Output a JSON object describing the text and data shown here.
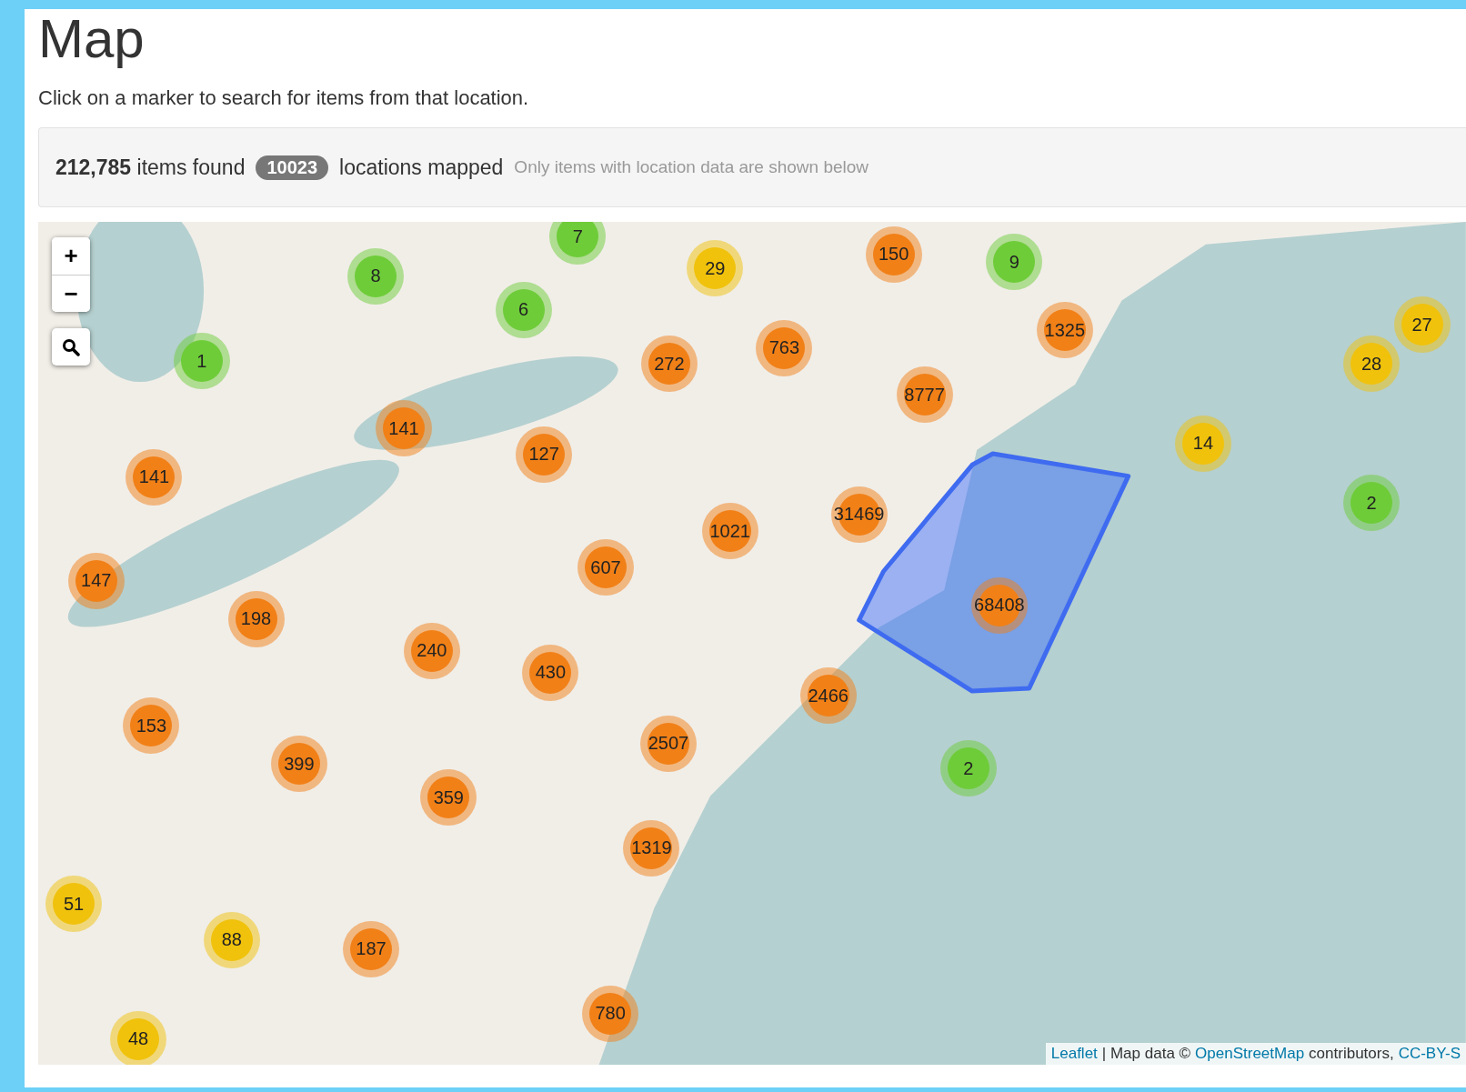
{
  "title": "Map",
  "intro": "Click on a marker to search for items from that location.",
  "summary": {
    "count": "212,785",
    "count_label": "items found",
    "locations_badge": "10023",
    "locations_label": "locations mapped",
    "note": "Only items with location data are shown below"
  },
  "map": {
    "zoom_in": "+",
    "zoom_out": "−",
    "markers": [
      {
        "count": "8",
        "color": "#6ecc39"
      },
      {
        "count": "7",
        "color": "#6ecc39"
      },
      {
        "count": "29",
        "color": "#f0c20c"
      },
      {
        "count": "150",
        "color": "#f18017"
      },
      {
        "count": "9",
        "color": "#6ecc39"
      },
      {
        "count": "1",
        "color": "#6ecc39"
      },
      {
        "count": "6",
        "color": "#6ecc39"
      },
      {
        "count": "272",
        "color": "#f18017"
      },
      {
        "count": "763",
        "color": "#f18017"
      },
      {
        "count": "1325",
        "color": "#f18017"
      },
      {
        "count": "28",
        "color": "#f0c20c"
      },
      {
        "count": "27",
        "color": "#f0c20c"
      },
      {
        "count": "141",
        "color": "#f18017"
      },
      {
        "count": "141",
        "color": "#f18017"
      },
      {
        "count": "127",
        "color": "#f18017"
      },
      {
        "count": "8777",
        "color": "#f18017"
      },
      {
        "count": "14",
        "color": "#f0c20c"
      },
      {
        "count": "1021",
        "color": "#f18017"
      },
      {
        "count": "31469",
        "color": "#f18017"
      },
      {
        "count": "2",
        "color": "#6ecc39"
      },
      {
        "count": "147",
        "color": "#f18017"
      },
      {
        "count": "198",
        "color": "#f18017"
      },
      {
        "count": "607",
        "color": "#f18017"
      },
      {
        "count": "68408",
        "color": "#f18017"
      },
      {
        "count": "240",
        "color": "#f18017"
      },
      {
        "count": "430",
        "color": "#f18017"
      },
      {
        "count": "2466",
        "color": "#f18017"
      },
      {
        "count": "153",
        "color": "#f18017"
      },
      {
        "count": "399",
        "color": "#f18017"
      },
      {
        "count": "359",
        "color": "#f18017"
      },
      {
        "count": "2507",
        "color": "#f18017"
      },
      {
        "count": "2",
        "color": "#6ecc39"
      },
      {
        "count": "1319",
        "color": "#f18017"
      },
      {
        "count": "51",
        "color": "#f0c20c"
      },
      {
        "count": "88",
        "color": "#f0c20c"
      },
      {
        "count": "187",
        "color": "#f18017"
      },
      {
        "count": "48",
        "color": "#f0c20c"
      },
      {
        "count": "780",
        "color": "#f18017"
      }
    ],
    "attribution": [
      {
        "kind": "link",
        "text": "Leaflet"
      },
      {
        "kind": "text",
        "text": "| Map data ©"
      },
      {
        "kind": "link",
        "text": "OpenStreetMap"
      },
      {
        "kind": "text",
        "text": "contributors,"
      },
      {
        "kind": "link",
        "text": "CC-BY-S"
      }
    ]
  }
}
